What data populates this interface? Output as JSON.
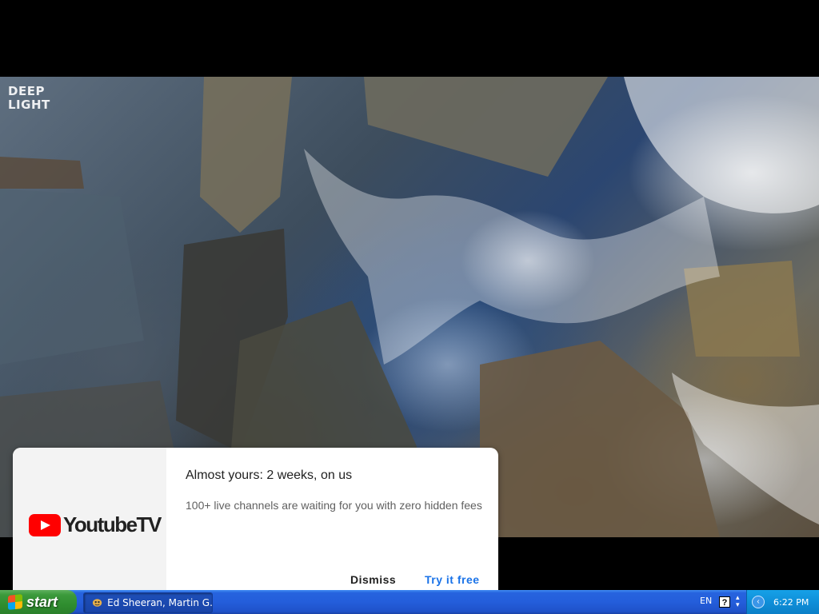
{
  "video": {
    "watermark_line1": "DEEP",
    "watermark_line2": "LIGHT"
  },
  "promo": {
    "brand": "YoutubeTV",
    "title": "Almost yours: 2 weeks, on us",
    "description": "100+ live channels are waiting for you with zero hidden fees",
    "dismiss_label": "Dismiss",
    "cta_label": "Try it free",
    "accent_color": "#1a73e8",
    "logo_color": "#ff0000"
  },
  "taskbar": {
    "start_label": "start",
    "task_label": "Ed Sheeran, Martin G...",
    "task_icon": "media-player-icon",
    "language": "EN",
    "help_icon": "?",
    "clock": "6:22 PM"
  }
}
